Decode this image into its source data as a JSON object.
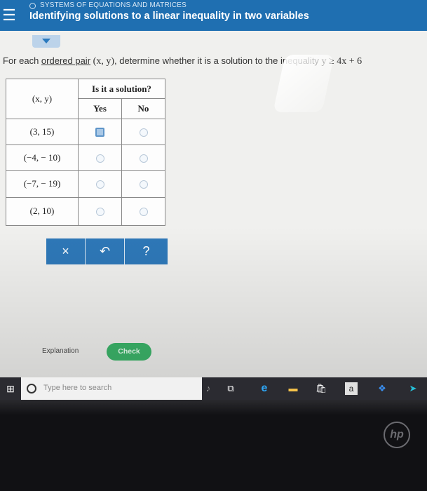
{
  "header": {
    "menu_icon": "hamburger-menu-icon",
    "topic": "SYSTEMS OF EQUATIONS AND MATRICES",
    "title": "Identifying solutions to a linear inequality in two variables"
  },
  "instruction": {
    "prefix": "For each ",
    "link": "ordered pair",
    "pair": "(x, y)",
    "middle": ", determine whether it is a solution to the inequality ",
    "inequality": "y ≥ 4x + 6"
  },
  "table": {
    "col_pair": "(x, y)",
    "col_group": "Is it a solution?",
    "col_yes": "Yes",
    "col_no": "No",
    "rows": [
      {
        "pair": "(3, 15)",
        "selected": "yes"
      },
      {
        "pair": "(−4, − 10)",
        "selected": null
      },
      {
        "pair": "(−7, − 19)",
        "selected": null
      },
      {
        "pair": "(2, 10)",
        "selected": null
      }
    ]
  },
  "actions": {
    "clear": "×",
    "undo": "↶",
    "help": "?"
  },
  "footer": {
    "explanation": "Explanation",
    "check": "Check"
  },
  "taskbar": {
    "search_placeholder": "Type here to search",
    "amazon_letter": "a"
  },
  "bezel": {
    "logo": "hp"
  },
  "colors": {
    "header_blue": "#1f6fb1",
    "action_blue": "#2e78b8",
    "check_green": "#3cb56a"
  }
}
